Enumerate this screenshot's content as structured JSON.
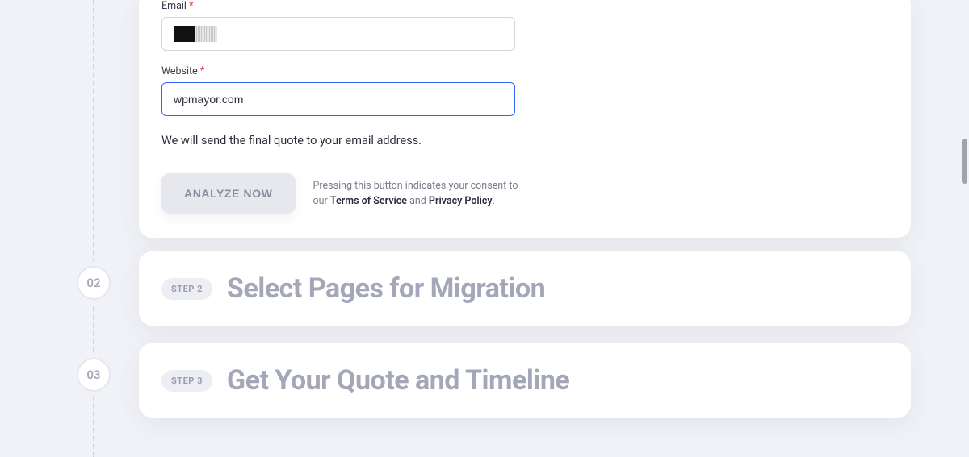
{
  "form": {
    "email": {
      "label": "Email",
      "required_mark": "*",
      "value": ""
    },
    "website": {
      "label": "Website",
      "required_mark": "*",
      "value": "wpmayor.com"
    },
    "hint": "We will send the final quote to your email address.",
    "button": "ANALYZE NOW",
    "consent_pre": "Pressing this button indicates your consent to our ",
    "tos": "Terms of Service",
    "consent_and": " and ",
    "privacy": "Privacy Policy",
    "consent_end": "."
  },
  "steps": {
    "s2": {
      "num": "02",
      "pill": "STEP 2",
      "title": "Select Pages for Migration"
    },
    "s3": {
      "num": "03",
      "pill": "STEP 3",
      "title": "Get Your Quote and Timeline"
    }
  }
}
